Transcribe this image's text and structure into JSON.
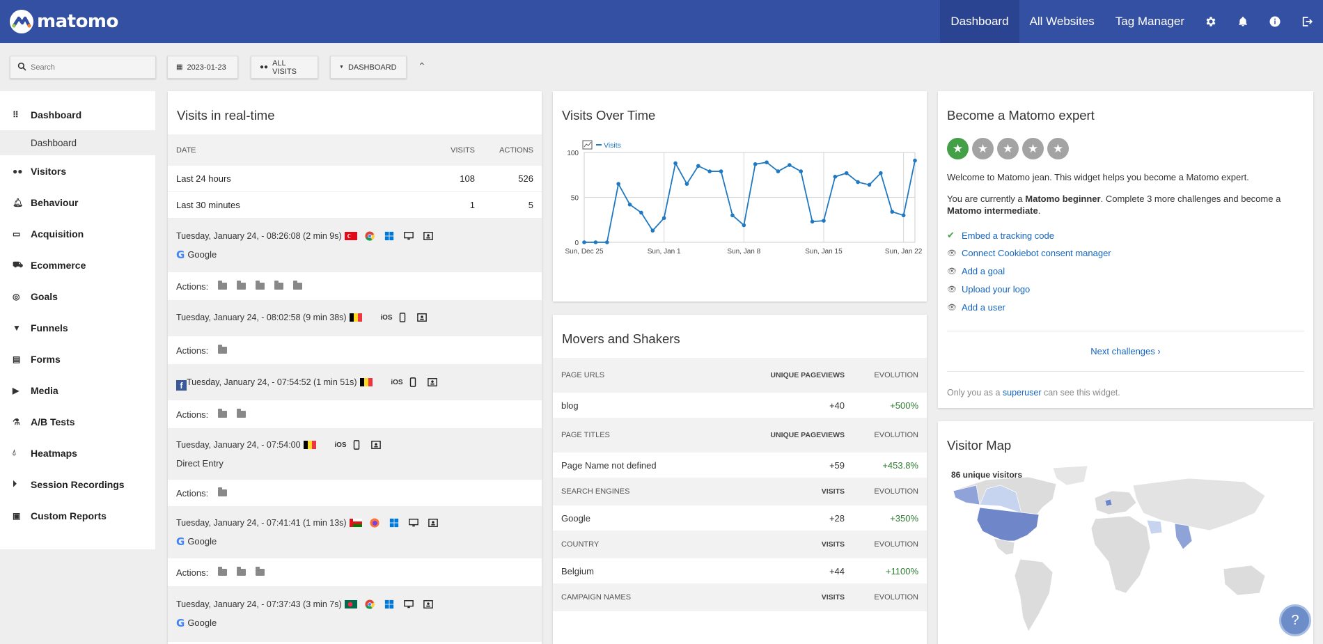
{
  "brand": {
    "name": "matomo"
  },
  "topnav": {
    "items": [
      "Dashboard",
      "All Websites",
      "Tag Manager"
    ],
    "active": "Dashboard",
    "icons": [
      "gear-icon",
      "bell-icon",
      "info-icon",
      "logout-icon"
    ]
  },
  "toolbar": {
    "search_placeholder": "Search",
    "date": "2023-01-23",
    "segment": "ALL VISITS",
    "dashboard": "DASHBOARD"
  },
  "sidebar": {
    "items": [
      "Dashboard",
      "Visitors",
      "Behaviour",
      "Acquisition",
      "Ecommerce",
      "Goals",
      "Funnels",
      "Forms",
      "Media",
      "A/B Tests",
      "Heatmaps",
      "Session Recordings",
      "Custom Reports"
    ],
    "sub": "Dashboard"
  },
  "realtime": {
    "title": "Visits in real-time",
    "headers": {
      "date": "DATE",
      "visits": "VISITS",
      "actions": "ACTIONS"
    },
    "rows": [
      {
        "label": "Last 24 hours",
        "visits": "108",
        "actions": "526"
      },
      {
        "label": "Last 30 minutes",
        "visits": "1",
        "actions": "5"
      }
    ],
    "actions_label": "Actions:",
    "visits": [
      {
        "time": "Tuesday, January 24, - 08:26:08 (2 min 9s)",
        "referrer": "Google",
        "folders": 5
      },
      {
        "time": "Tuesday, January 24, - 08:02:58 (9 min 38s)",
        "os": "iOS",
        "referrer": "",
        "folders": 1
      },
      {
        "time": "Tuesday, January 24, - 07:54:52 (1 min 51s)",
        "os": "iOS",
        "referrer": "",
        "folders": 2
      },
      {
        "time": "Tuesday, January 24, - 07:54:00",
        "os": "iOS",
        "referrer": "Direct Entry",
        "folders": 1
      },
      {
        "time": "Tuesday, January 24, - 07:41:41 (1 min 13s)",
        "referrer": "Google",
        "folders": 3
      },
      {
        "time": "Tuesday, January 24, - 07:37:43 (3 min 7s)",
        "referrer": "Google",
        "folders": 0
      }
    ],
    "colors": {
      "turkey": "#e30a17",
      "belgium_black": "#000000",
      "belgium_yellow": "#fdda24",
      "belgium_red": "#ef3340",
      "oman_red": "#db161b",
      "bangladesh_green": "#006a4e"
    }
  },
  "visits_over_time": {
    "title": "Visits Over Time",
    "legend": "Visits"
  },
  "chart_data": {
    "type": "line",
    "series": [
      {
        "name": "Visits",
        "values": [
          0,
          0,
          0,
          65,
          42,
          33,
          13,
          27,
          88,
          65,
          85,
          79,
          79,
          30,
          19,
          87,
          89,
          79,
          86,
          79,
          23,
          24,
          73,
          77,
          67,
          64,
          77,
          34,
          30,
          91
        ]
      }
    ],
    "x": [
      "Dec 25",
      "Dec 26",
      "Dec 27",
      "Dec 28",
      "Dec 29",
      "Dec 30",
      "Dec 31",
      "Jan 1",
      "Jan 2",
      "Jan 3",
      "Jan 4",
      "Jan 5",
      "Jan 6",
      "Jan 7",
      "Jan 8",
      "Jan 9",
      "Jan 10",
      "Jan 11",
      "Jan 12",
      "Jan 13",
      "Jan 14",
      "Jan 15",
      "Jan 16",
      "Jan 17",
      "Jan 18",
      "Jan 19",
      "Jan 20",
      "Jan 21",
      "Jan 22",
      "Jan 23"
    ],
    "xticks": [
      "Sun, Dec 25",
      "Sun, Jan 1",
      "Sun, Jan 8",
      "Sun, Jan 15",
      "Sun, Jan 22"
    ],
    "yticks": [
      "0",
      "50",
      "100"
    ],
    "ylim": [
      0,
      100
    ],
    "color": "#1f78c1"
  },
  "movers": {
    "title": "Movers and Shakers",
    "sections": [
      {
        "header": "PAGE URLS",
        "metric": "UNIQUE PAGEVIEWS",
        "evolution": "EVOLUTION",
        "row": {
          "label": "blog",
          "value": "+40",
          "evo": "+500%"
        }
      },
      {
        "header": "PAGE TITLES",
        "metric": "UNIQUE PAGEVIEWS",
        "evolution": "EVOLUTION",
        "row": {
          "label": "Page Name not defined",
          "value": "+59",
          "evo": "+453.8%"
        }
      },
      {
        "header": "SEARCH ENGINES",
        "metric": "VISITS",
        "evolution": "EVOLUTION",
        "row": {
          "label": "Google",
          "value": "+28",
          "evo": "+350%"
        }
      },
      {
        "header": "COUNTRY",
        "metric": "VISITS",
        "evolution": "EVOLUTION",
        "row": {
          "label": "Belgium",
          "value": "+44",
          "evo": "+1100%"
        }
      },
      {
        "header": "CAMPAIGN NAMES",
        "metric": "VISITS",
        "evolution": "EVOLUTION"
      }
    ]
  },
  "expert": {
    "title": "Become a Matomo expert",
    "stars_on": 1,
    "stars_total": 5,
    "welcome": "Welcome to Matomo jean. This widget helps you become a Matomo expert.",
    "status_pre": "You are currently a ",
    "status_level": "Matomo beginner",
    "status_mid": ". Complete 3 more challenges and become a ",
    "status_next": "Matomo intermediate",
    "status_end": ".",
    "challenges": [
      {
        "label": "Embed a tracking code",
        "done": true
      },
      {
        "label": "Connect Cookiebot consent manager",
        "done": false
      },
      {
        "label": "Add a goal",
        "done": false
      },
      {
        "label": "Upload your logo",
        "done": false
      },
      {
        "label": "Add a user",
        "done": false
      }
    ],
    "next": "Next challenges ›",
    "footer_pre": "Only you as a ",
    "footer_link": "superuser",
    "footer_post": " can see this widget."
  },
  "visitor_map": {
    "title": "Visitor Map",
    "label": "86 unique visitors"
  }
}
